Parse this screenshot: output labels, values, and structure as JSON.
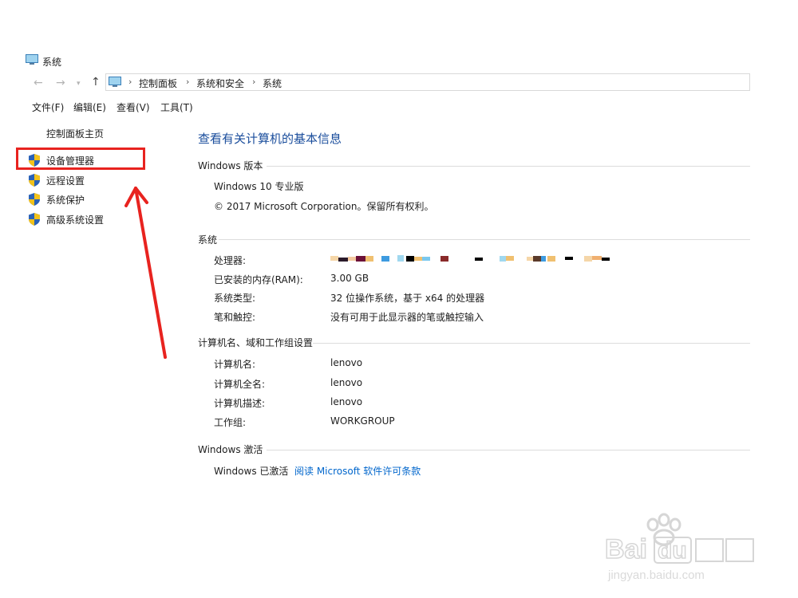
{
  "window": {
    "title": "系统"
  },
  "breadcrumb": [
    "控制面板",
    "系统和安全",
    "系统"
  ],
  "menu": [
    "文件(F)",
    "编辑(E)",
    "查看(V)",
    "工具(T)"
  ],
  "sidebar": {
    "home": "控制面板主页",
    "items": [
      {
        "label": "设备管理器",
        "icon": "shield-icon"
      },
      {
        "label": "远程设置",
        "icon": "shield-icon"
      },
      {
        "label": "系统保护",
        "icon": "shield-icon"
      },
      {
        "label": "高级系统设置",
        "icon": "shield-icon"
      }
    ]
  },
  "main": {
    "heading": "查看有关计算机的基本信息",
    "edition": {
      "title": "Windows 版本",
      "name": "Windows 10 专业版",
      "copyright": "© 2017 Microsoft Corporation。保留所有权利。"
    },
    "system": {
      "title": "系统",
      "rows": [
        {
          "label": "处理器:",
          "value": ""
        },
        {
          "label": "已安装的内存(RAM):",
          "value": "3.00 GB"
        },
        {
          "label": "系统类型:",
          "value": "32 位操作系统，基于 x64 的处理器"
        },
        {
          "label": "笔和触控:",
          "value": "没有可用于此显示器的笔或触控输入"
        }
      ]
    },
    "computer": {
      "title": "计算机名、域和工作组设置",
      "rows": [
        {
          "label": "计算机名:",
          "value": "lenovo"
        },
        {
          "label": "计算机全名:",
          "value": "lenovo"
        },
        {
          "label": "计算机描述:",
          "value": "lenovo"
        },
        {
          "label": "工作组:",
          "value": "WORKGROUP"
        }
      ]
    },
    "activation": {
      "title": "Windows 激活",
      "status": "Windows 已激活",
      "link": "阅读 Microsoft 软件许可条款"
    }
  },
  "colors": {
    "accent_heading": "#1a4d9c",
    "link": "#0066cc",
    "highlight_box": "#e8231f",
    "shield_blue": "#2a62b8",
    "shield_yellow": "#f2c21b"
  }
}
